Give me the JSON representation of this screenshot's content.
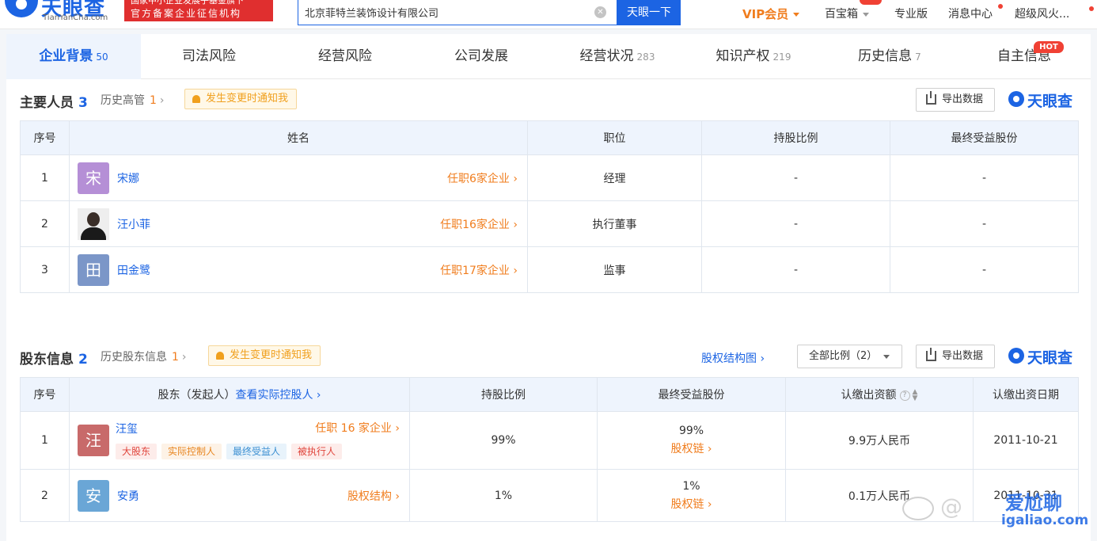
{
  "header": {
    "logo_text": "天眼查",
    "logo_sub": "TianYanCha.com",
    "banner_top": "国家中小企业发展子基金旗下",
    "banner_bottom": "官方备案企业征信机构",
    "search_value": "北京菲特兰装饰设计有限公司",
    "search_button": "天眼一下",
    "nav": [
      "VIP会员",
      "百宝箱",
      "专业版",
      "消息中心",
      "超级风火..."
    ]
  },
  "tabs": [
    {
      "label": "企业背景",
      "count": "50"
    },
    {
      "label": "司法风险",
      "count": ""
    },
    {
      "label": "经营风险",
      "count": ""
    },
    {
      "label": "公司发展",
      "count": ""
    },
    {
      "label": "经营状况",
      "count": "283"
    },
    {
      "label": "知识产权",
      "count": "219"
    },
    {
      "label": "历史信息",
      "count": "7"
    },
    {
      "label": "自主信息",
      "count": ""
    }
  ],
  "tab_hot": "HOT",
  "personnel": {
    "title": "主要人员",
    "count": "3",
    "history_label": "历史高管",
    "history_count": "1",
    "notify": "发生变更时通知我",
    "export": "导出数据",
    "brand": "天眼查",
    "headers": [
      "序号",
      "姓名",
      "职位",
      "持股比例",
      "最终受益股份"
    ],
    "rows": [
      {
        "idx": "1",
        "avatar": "宋",
        "name": "宋娜",
        "posts": "任职6家企业",
        "position": "经理",
        "ratio": "-",
        "benefit": "-"
      },
      {
        "idx": "2",
        "avatar": "",
        "name": "汪小菲",
        "posts": "任职16家企业",
        "position": "执行董事",
        "ratio": "-",
        "benefit": "-"
      },
      {
        "idx": "3",
        "avatar": "田",
        "name": "田金鹭",
        "posts": "任职17家企业",
        "position": "监事",
        "ratio": "-",
        "benefit": "-"
      }
    ]
  },
  "shareholders": {
    "title": "股东信息",
    "count": "2",
    "history_label": "历史股东信息",
    "history_count": "1",
    "notify": "发生变更时通知我",
    "structure_link": "股权结构图",
    "filter": "全部比例（2）",
    "export": "导出数据",
    "brand": "天眼查",
    "headers": {
      "idx": "序号",
      "holder": "股东（发起人）",
      "holder_link": "查看实际控股人",
      "ratio": "持股比例",
      "benefit": "最终受益股份",
      "capital": "认缴出资额",
      "date": "认缴出资日期"
    },
    "rows": [
      {
        "idx": "1",
        "avatar": "汪",
        "name": "汪玺",
        "posts": "任职 16 家企业",
        "tags": [
          "大股东",
          "实际控制人",
          "最终受益人",
          "被执行人"
        ],
        "ratio": "99%",
        "benefit": "99%",
        "benefit_link": "股权链",
        "capital": "9.9万人民币",
        "date": "2011-10-21"
      },
      {
        "idx": "2",
        "avatar": "安",
        "name": "安勇",
        "posts": "股权结构",
        "tags": [],
        "ratio": "1%",
        "benefit": "1%",
        "benefit_link": "股权链",
        "capital": "0.1万人民币",
        "date": "2011-10-31"
      }
    ]
  },
  "watermark": {
    "text": "爱尬聊",
    "url": "igaliao.com"
  },
  "colors": {
    "primary": "#1c64e3",
    "accent_orange": "#f07d1e",
    "avatar_song": "#b58fd6",
    "avatar_tian": "#7b96c8",
    "avatar_wang": "#c86a6a",
    "avatar_an": "#6aa6d6"
  }
}
